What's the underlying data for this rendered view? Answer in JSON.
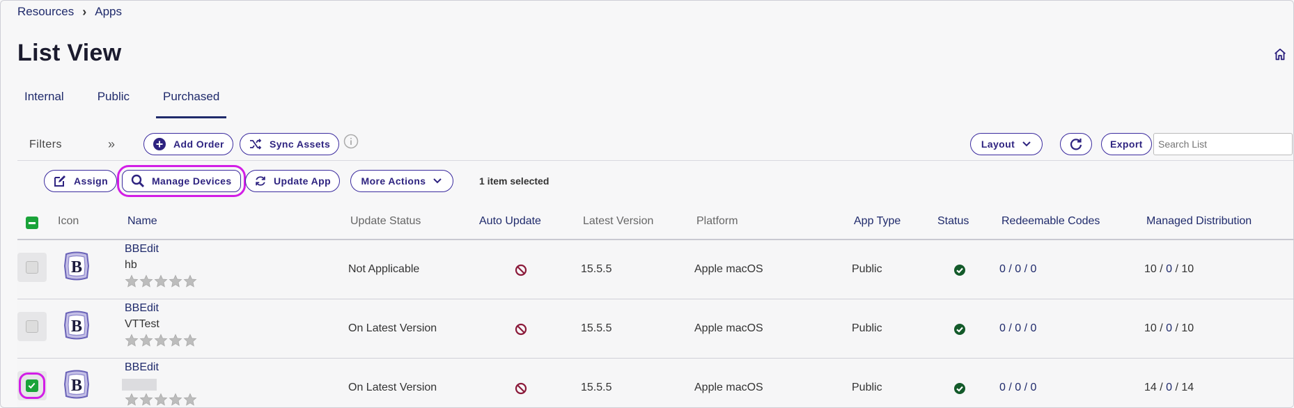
{
  "breadcrumb": {
    "root": "Resources",
    "current": "Apps"
  },
  "page": {
    "title": "List View"
  },
  "tabs": [
    {
      "label": "Internal",
      "active": false
    },
    {
      "label": "Public",
      "active": false
    },
    {
      "label": "Purchased",
      "active": true
    }
  ],
  "toolbar": {
    "filters_label": "Filters",
    "add_order": "Add Order",
    "sync_assets": "Sync Assets",
    "layout": "Layout",
    "export": "Export",
    "search_placeholder": "Search List"
  },
  "actions": {
    "assign": "Assign",
    "manage_devices": "Manage Devices",
    "update_app": "Update App",
    "more_actions": "More Actions",
    "selection_status": "1 item selected"
  },
  "table": {
    "columns": {
      "icon": "Icon",
      "name": "Name",
      "update_status": "Update Status",
      "auto_update": "Auto Update",
      "latest_version": "Latest Version",
      "platform": "Platform",
      "app_type": "App Type",
      "status": "Status",
      "redeemable_codes": "Redeemable Codes",
      "managed_distribution": "Managed Distribution"
    },
    "rows": [
      {
        "name": "BBEdit",
        "subtitle": "hb",
        "checked": false,
        "update_status": "Not Applicable",
        "latest_version": "15.5.5",
        "platform": "Apple macOS",
        "app_type": "Public",
        "codes": "0 / 0 / 0",
        "dist_a": "10",
        "dist_b": "0",
        "dist_c": "10",
        "rating": 0
      },
      {
        "name": "BBEdit",
        "subtitle": "VTTest",
        "checked": false,
        "update_status": "On Latest Version",
        "latest_version": "15.5.5",
        "platform": "Apple macOS",
        "app_type": "Public",
        "codes": "0 / 0 / 0",
        "dist_a": "10",
        "dist_b": "0",
        "dist_c": "10",
        "rating": 0
      },
      {
        "name": "BBEdit",
        "subtitle": "",
        "checked": true,
        "update_status": "On Latest Version",
        "latest_version": "15.5.5",
        "platform": "Apple macOS",
        "app_type": "Public",
        "codes": "0 / 0 / 0",
        "dist_a": "14",
        "dist_b": "0",
        "dist_c": "14",
        "rating": 0
      }
    ]
  },
  "colors": {
    "accent": "#2e2380",
    "link": "#1f2a6b",
    "highlight": "#d21ee6",
    "success": "#1aa33a",
    "disabled_red": "#8b1a3a"
  },
  "icons": {
    "home": "home-icon",
    "info": "info-icon",
    "refresh": "refresh-icon",
    "add": "plus-circle-icon",
    "sync": "shuffle-icon",
    "assign": "edit-icon",
    "manage": "search-icon",
    "update": "refresh-icon",
    "auto_update_off": "prohibited-icon",
    "status_ok": "check-circle-icon",
    "star": "star-icon",
    "app": "bbedit-logo-icon"
  }
}
